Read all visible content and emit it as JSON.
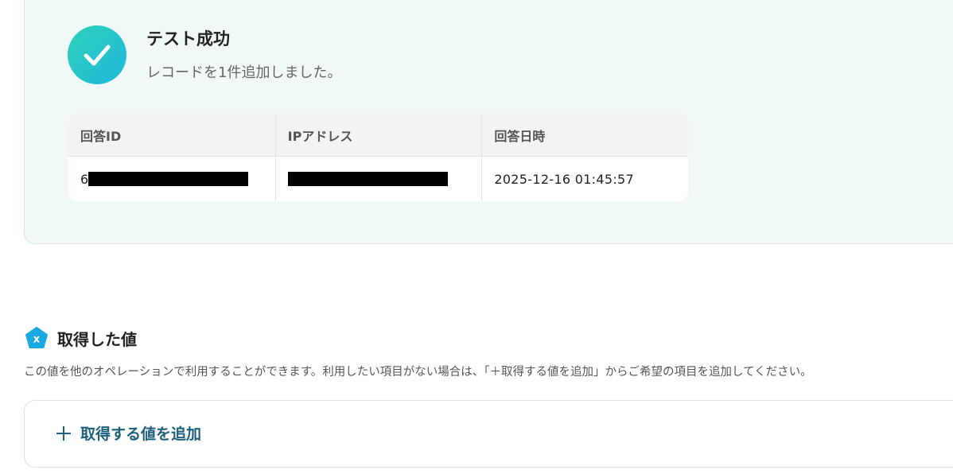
{
  "result": {
    "title": "テスト成功",
    "message": "レコードを1件追加しました。",
    "columns": [
      "回答ID",
      "IPアドレス",
      "回答日時"
    ],
    "row": {
      "response_id_prefix": "6",
      "response_datetime": "2025-12-16 01:45:57"
    }
  },
  "acquired": {
    "heading": "取得した値",
    "icon_letter": "x",
    "description": "この値を他のオペレーションで利用することができます。利用したい項目がない場合は、「＋取得する値を追加」からご希望の項目を追加してください。",
    "add_button_label": "取得する値を追加"
  },
  "colors": {
    "panel_bg": "#f1f9f8",
    "check_gradient_start": "#2ed1b8",
    "check_gradient_end": "#20b8de",
    "icon_blue": "#1aa9e0",
    "add_button_text": "#1c5f7a"
  },
  "icons": {
    "success": "check-circle-icon",
    "acquired": "pentagon-x-icon",
    "add": "plus-icon"
  }
}
